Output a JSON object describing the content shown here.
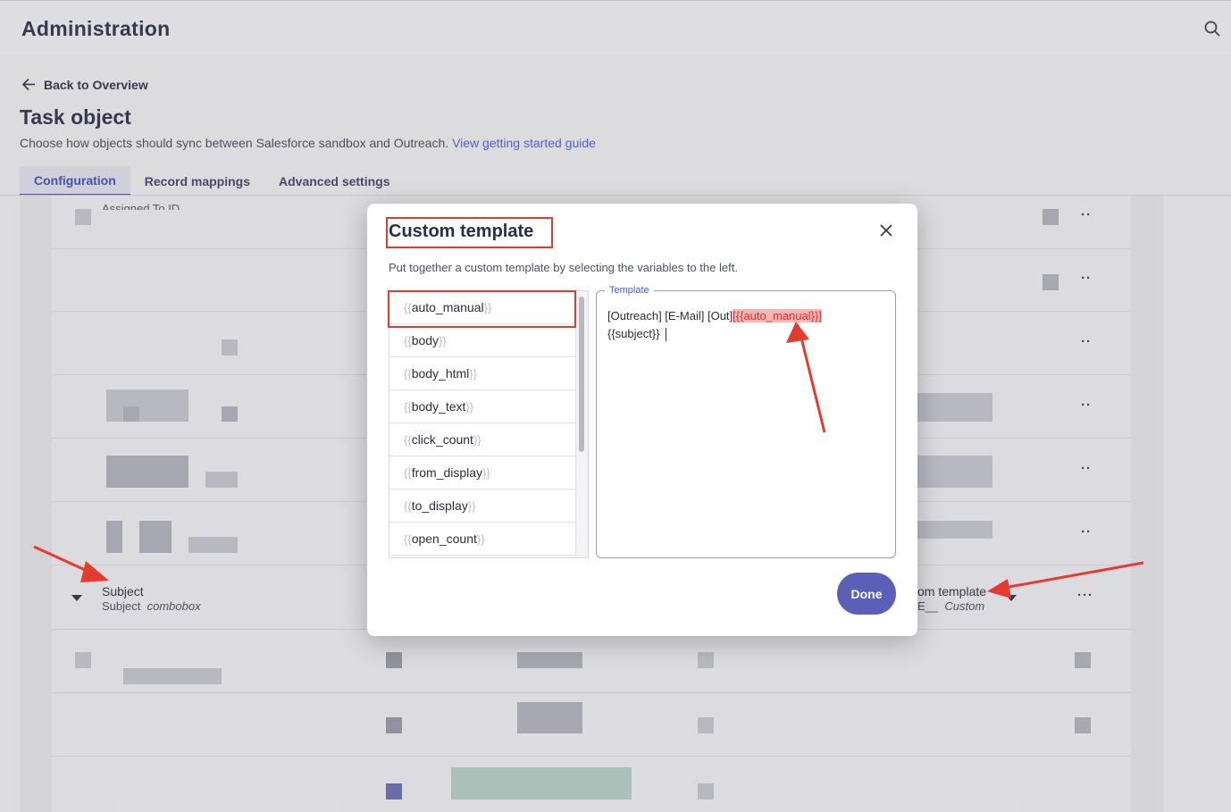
{
  "app": {
    "title": "Administration"
  },
  "nav": {
    "back_label": "Back to Overview"
  },
  "page": {
    "title": "Task object",
    "description": "Choose how objects should sync between Salesforce sandbox and Outreach.",
    "guide_link": "View getting started guide"
  },
  "tabs": [
    {
      "label": "Configuration",
      "active": true
    },
    {
      "label": "Record mappings",
      "active": false
    },
    {
      "label": "Advanced settings",
      "active": false
    }
  ],
  "background_rows": {
    "first_label": "Assigned To ID",
    "subject_row": {
      "label": "Subject",
      "sub_label": "Subject",
      "sub_type": "combobox",
      "right_label": "om template",
      "right_sub_prefix": "E__",
      "right_sub_type": "Custom"
    }
  },
  "modal": {
    "title": "Custom template",
    "description": "Put together a custom template by selecting the variables to the left.",
    "variables": [
      "auto_manual",
      "body",
      "body_html",
      "body_text",
      "click_count",
      "from_display",
      "to_display",
      "open_count"
    ],
    "open_brace": "{{",
    "close_brace": "}}",
    "template_label": "Template",
    "template_text_line1": "[Outreach] [E-Mail] [Out]",
    "template_highlight": "[{{auto_manual}}]",
    "template_text_line2": "{{subject}}",
    "done_label": "Done"
  },
  "colors": {
    "accent": "#5b5fb8",
    "link": "#4b5bd8",
    "annotation_red": "#e53a2f"
  }
}
